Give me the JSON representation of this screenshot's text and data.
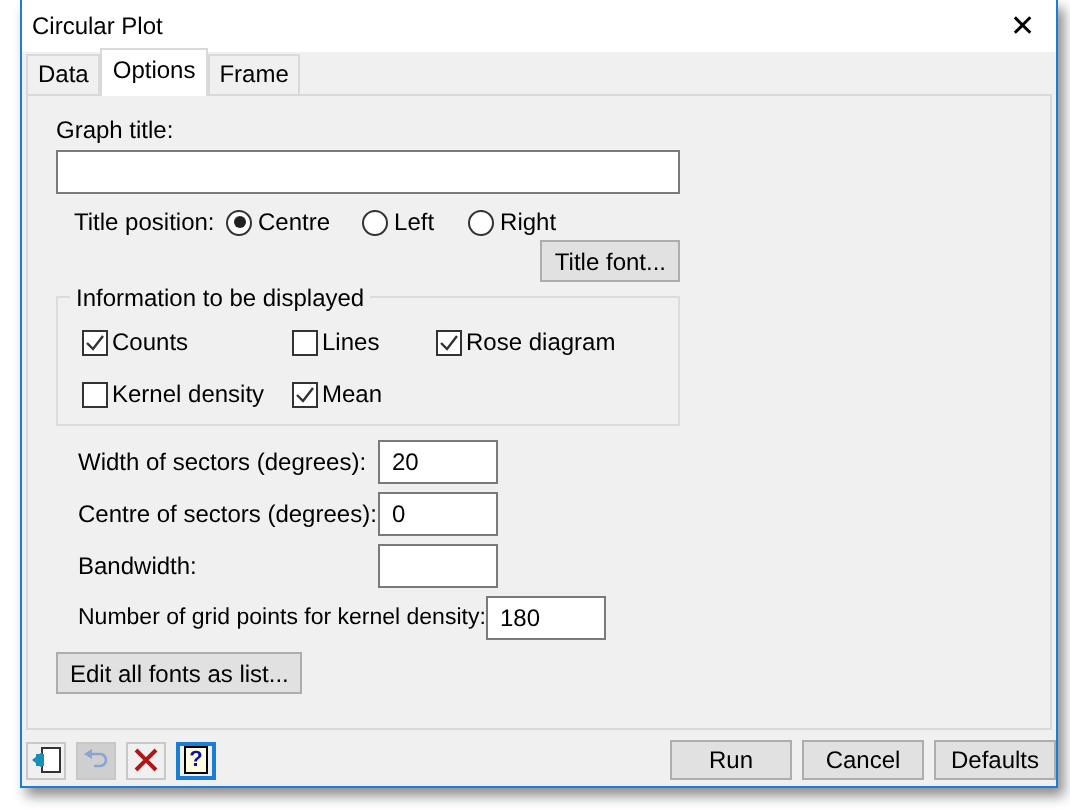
{
  "window": {
    "title": "Circular Plot",
    "close": "✕"
  },
  "tabs": [
    {
      "label": "Data",
      "selected": false
    },
    {
      "label": "Options",
      "selected": true
    },
    {
      "label": "Frame",
      "selected": false
    }
  ],
  "graph_title": {
    "label": "Graph title:"
  },
  "title_position": {
    "label": "Title position:",
    "options": [
      {
        "label": "Centre",
        "selected": true
      },
      {
        "label": "Left",
        "selected": false
      },
      {
        "label": "Right",
        "selected": false
      }
    ]
  },
  "title_font_button": "Title font...",
  "information": {
    "legend": "Information to be displayed",
    "items": [
      {
        "label": "Counts",
        "checked": true
      },
      {
        "label": "Lines",
        "checked": false
      },
      {
        "label": "Rose diagram",
        "checked": true
      },
      {
        "label": "Kernel density",
        "checked": false
      },
      {
        "label": "Mean",
        "checked": true
      }
    ]
  },
  "fields": [
    {
      "label": "Width of sectors (degrees):",
      "value": "20",
      "kind": "short"
    },
    {
      "label": "Centre of sectors (degrees):",
      "value": "0",
      "kind": "short"
    },
    {
      "label": "Bandwidth:",
      "kind": "short"
    },
    {
      "label": "Number of grid points for kernel density:",
      "value": "180",
      "kind": "long"
    }
  ],
  "edit_fonts_button": "Edit all fonts as list...",
  "toolbar": [
    {
      "kind": "transfer",
      "disabled": false,
      "selected": false
    },
    {
      "kind": "undo",
      "disabled": true,
      "selected": false
    },
    {
      "kind": "clear",
      "disabled": false,
      "selected": false
    },
    {
      "kind": "help",
      "disabled": false,
      "selected": true
    }
  ],
  "help_glyph": "?",
  "buttons": [
    "Run",
    "Cancel",
    "Defaults"
  ]
}
